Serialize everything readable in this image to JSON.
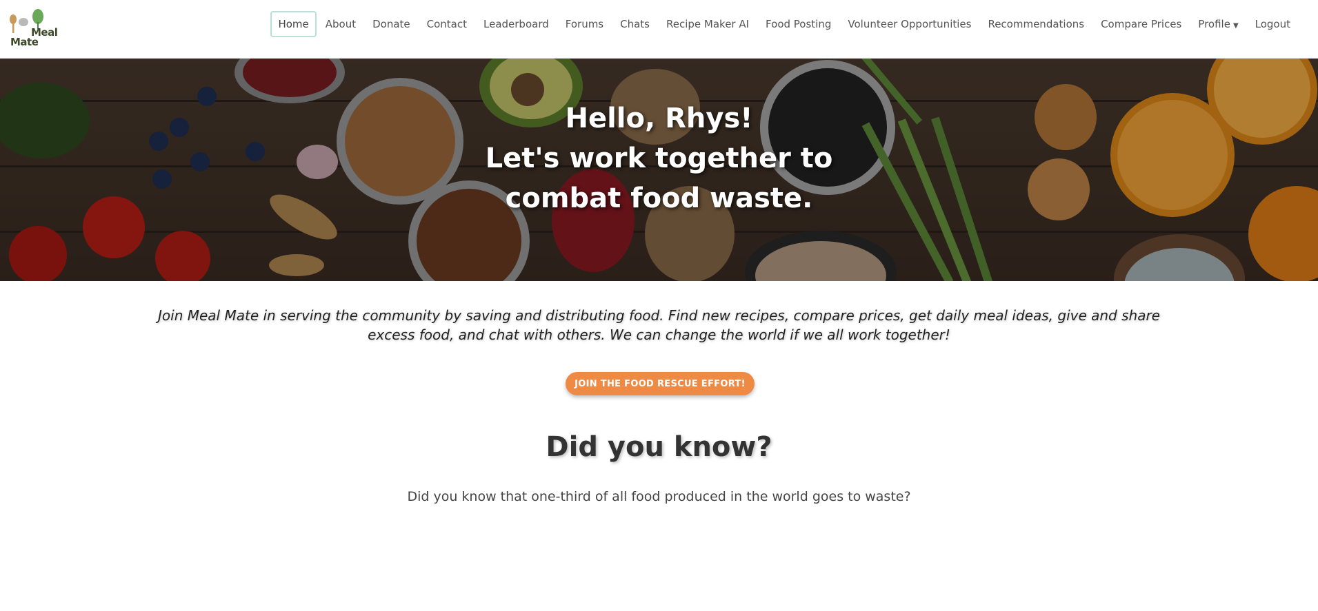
{
  "brand": {
    "name_line1": "Meal",
    "name_line2": "Mate"
  },
  "nav": {
    "items": [
      {
        "label": "Home"
      },
      {
        "label": "About"
      },
      {
        "label": "Donate"
      },
      {
        "label": "Contact"
      },
      {
        "label": "Leaderboard"
      },
      {
        "label": "Forums"
      },
      {
        "label": "Chats"
      },
      {
        "label": "Recipe Maker AI"
      },
      {
        "label": "Food Posting"
      },
      {
        "label": "Volunteer Opportunities"
      },
      {
        "label": "Recommendations"
      },
      {
        "label": "Compare Prices"
      },
      {
        "label": "Profile"
      },
      {
        "label": "Logout"
      }
    ]
  },
  "hero": {
    "line1": "Hello, Rhys!",
    "line2": "Let's work together to",
    "line3": "combat food waste."
  },
  "intro": {
    "text": "Join Meal Mate in serving the community by saving and distributing food. Find new recipes, compare prices, get daily meal ideas, give and share excess food, and chat with others. We can change the world if we all work together!"
  },
  "cta": {
    "label": "JOIN THE FOOD RESCUE EFFORT!"
  },
  "did_you_know": {
    "title": "Did you know?",
    "text": "Did you know that one-third of all food produced in the world goes to waste?"
  },
  "colors": {
    "accent": "#ee8a44",
    "active_border": "#b8e0d6",
    "logo_green": "#6aa85a"
  }
}
